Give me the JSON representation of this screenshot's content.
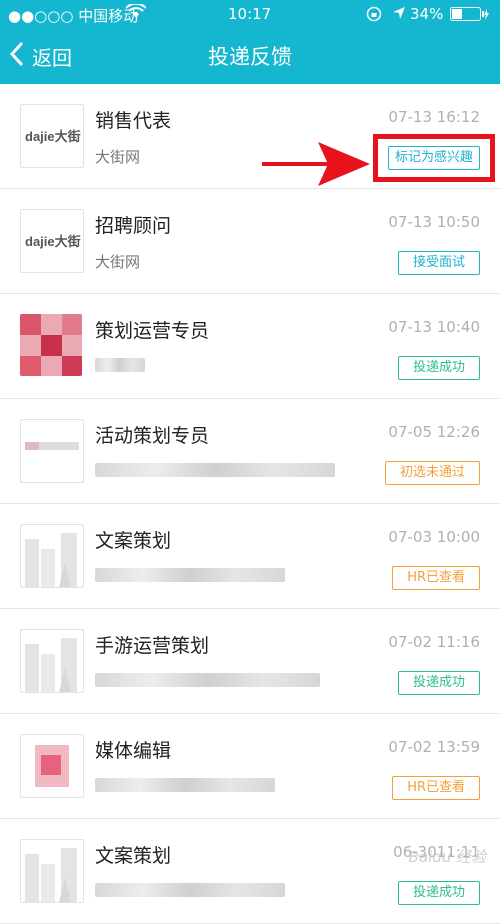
{
  "status_bar": {
    "carrier": "●●○○○ 中国移动",
    "time": "10:17",
    "battery": "34%"
  },
  "nav": {
    "back_label": "返回",
    "title": "投递反馈"
  },
  "colors": {
    "brand": "#14b7cf",
    "annotation": "#e8121b"
  },
  "items": [
    {
      "title": "销售代表",
      "company": "大街网",
      "time": "07-13 16:12",
      "status": "标记为感兴趣",
      "status_color": "blue"
    },
    {
      "title": "招聘顾问",
      "company": "大街网",
      "time": "07-13 10:50",
      "status": "接受面试",
      "status_color": "blue"
    },
    {
      "title": "策划运营专员",
      "company": "",
      "time": "07-13 10:40",
      "status": "投递成功",
      "status_color": "green"
    },
    {
      "title": "活动策划专员",
      "company": "",
      "time": "07-05 12:26",
      "status": "初选未通过",
      "status_color": "orange"
    },
    {
      "title": "文案策划",
      "company": "",
      "time": "07-03 10:00",
      "status": "HR已查看",
      "status_color": "orange"
    },
    {
      "title": "手游运营策划",
      "company": "",
      "time": "07-02 11:16",
      "status": "投递成功",
      "status_color": "green"
    },
    {
      "title": "媒体编辑",
      "company": "",
      "time": "07-02 13:59",
      "status": "HR已查看",
      "status_color": "orange"
    },
    {
      "title": "文案策划",
      "company": "",
      "time": "06-3011:11",
      "status": "投递成功",
      "status_color": "green"
    }
  ],
  "logo_text": "dajie大街",
  "watermark": "Baidu 经验"
}
